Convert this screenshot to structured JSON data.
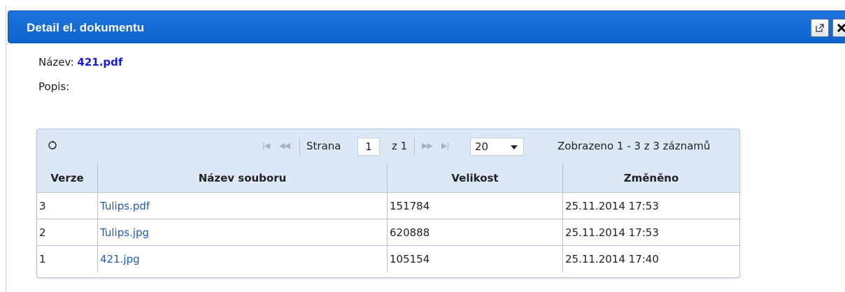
{
  "dialog": {
    "title": "Detail el. dokumentu",
    "buttons": [
      {
        "name": "popout",
        "icon": "external-link-icon"
      },
      {
        "name": "close",
        "icon": "close-icon"
      }
    ]
  },
  "document": {
    "name_label": "Název:",
    "name_value": "421.pdf",
    "description_label": "Popis:",
    "description_value": ""
  },
  "pager": {
    "page_label": "Strana",
    "page_value": "1",
    "of_label": "z 1",
    "page_size": "20",
    "records_text": "Zobrazeno 1 - 3 z 3 záznamů"
  },
  "table": {
    "columns": [
      "Verze",
      "Název souboru",
      "Velikost",
      "Změněno"
    ],
    "rows": [
      {
        "version": "3",
        "filename": "Tulips.pdf",
        "size": "151784",
        "changed": "25.11.2014 17:53"
      },
      {
        "version": "2",
        "filename": "Tulips.jpg",
        "size": "620888",
        "changed": "25.11.2014 17:53"
      },
      {
        "version": "1",
        "filename": "421.jpg",
        "size": "105154",
        "changed": "25.11.2014 17:40"
      }
    ]
  },
  "colors": {
    "titlebar": "#1169d6",
    "header_bg": "#dde8f6",
    "link": "#1a5fb4",
    "name_value": "#1a1adb"
  }
}
